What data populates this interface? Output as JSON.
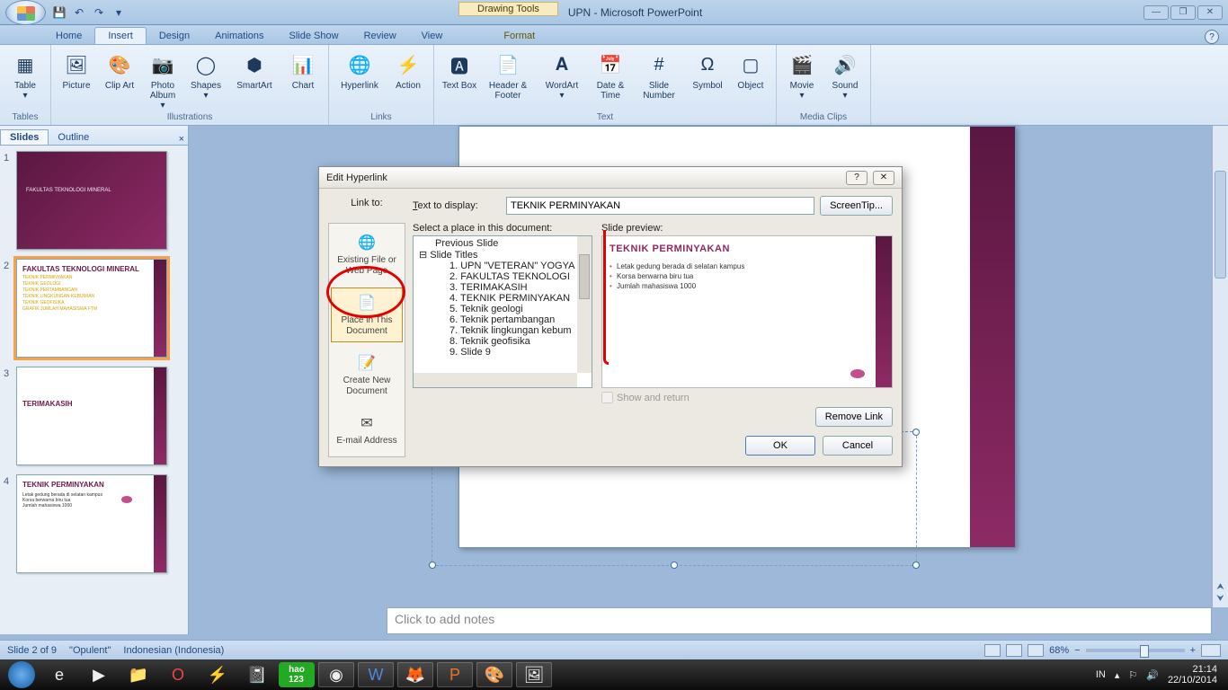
{
  "app": {
    "title": "UPN - Microsoft PowerPoint",
    "contextual_tab": "Drawing Tools"
  },
  "ribbon": {
    "tabs": [
      "Home",
      "Insert",
      "Design",
      "Animations",
      "Slide Show",
      "Review",
      "View",
      "Format"
    ],
    "active_tab": "Insert",
    "groups": {
      "tables": {
        "label": "Tables",
        "items": [
          "Table"
        ]
      },
      "illustrations": {
        "label": "Illustrations",
        "items": [
          "Picture",
          "Clip Art",
          "Photo Album",
          "Shapes",
          "SmartArt",
          "Chart"
        ]
      },
      "links": {
        "label": "Links",
        "items": [
          "Hyperlink",
          "Action"
        ]
      },
      "text": {
        "label": "Text",
        "items": [
          "Text Box",
          "Header & Footer",
          "WordArt",
          "Date & Time",
          "Slide Number",
          "Symbol",
          "Object"
        ]
      },
      "media": {
        "label": "Media Clips",
        "items": [
          "Movie",
          "Sound"
        ]
      }
    }
  },
  "panel": {
    "tabs": [
      "Slides",
      "Outline"
    ],
    "active": "Slides"
  },
  "thumbs": [
    {
      "n": 1,
      "title": "FAKULTAS TEKNOLOGI MINERAL",
      "style": "full"
    },
    {
      "n": 2,
      "title": "FAKULTAS TEKNOLOGI MINERAL",
      "style": "list",
      "selected": true,
      "lines": [
        "TEKNIK PERMINYAKAN",
        "TEKNIK GEOLOGI",
        "TEKNIK PERTAMBANGAN",
        "TEKNIK LINGKUNGAN KEBUMIAN",
        "TEKNIK GEOFISIKA",
        "GRAFIK JUMLAH MAHASISWA FTM"
      ]
    },
    {
      "n": 3,
      "title": "TERIMAKASIH",
      "style": "plain"
    },
    {
      "n": 4,
      "title": "TEKNIK PERMINYAKAN",
      "style": "detail",
      "lines": [
        "Letak gedung berada di selatan kampus",
        "Korsa berwarna biru tua",
        "Jumlah mahasiswa 1000"
      ]
    }
  ],
  "dialog": {
    "title": "Edit Hyperlink",
    "link_to_label": "Link to:",
    "text_to_display_label": "Text to display:",
    "text_to_display_value": "TEKNIK PERMINYAKAN",
    "screentip": "ScreenTip...",
    "select_label": "Select a place in this document:",
    "preview_label": "Slide preview:",
    "linkto": [
      "Existing File or Web Page",
      "Place in This Document",
      "Create New Document",
      "E-mail Address"
    ],
    "linkto_selected": 1,
    "tree": {
      "previous": "Previous Slide",
      "slide_titles": "Slide Titles",
      "items": [
        "1. UPN \"VETERAN\" YOGYA",
        "2. FAKULTAS TEKNOLOGI",
        "3. TERIMAKASIH",
        "4. TEKNIK PERMINYAKAN",
        "5. Teknik geologi",
        "6. Teknik pertambangan",
        "7. Teknik lingkungan kebum",
        "8. Teknik geofisika",
        "9. Slide 9"
      ]
    },
    "preview": {
      "title": "TEKNIK PERMINYAKAN",
      "bullets": [
        "Letak gedung berada di selatan kampus",
        "Korsa berwarna biru tua",
        "Jumlah mahasiswa 1000"
      ]
    },
    "show_and_return": "Show and return",
    "remove_link": "Remove Link",
    "ok": "OK",
    "cancel": "Cancel"
  },
  "notes_placeholder": "Click to add notes",
  "status": {
    "slide": "Slide 2 of 9",
    "theme": "\"Opulent\"",
    "lang": "Indonesian (Indonesia)",
    "zoom": "68%",
    "ime": "IN"
  },
  "clock": {
    "time": "21:14",
    "date": "22/10/2014"
  }
}
